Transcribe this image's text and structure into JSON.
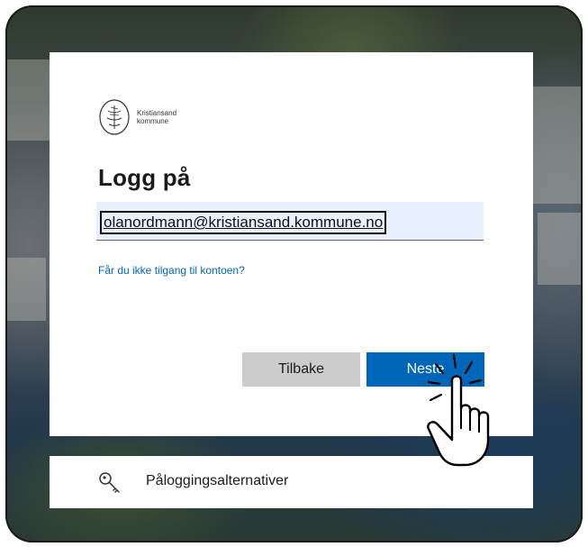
{
  "logo": {
    "icon": "kristiansand-emblem",
    "line1": "Kristiansand",
    "line2": "kommune"
  },
  "signin": {
    "title": "Logg på",
    "email_value": "olanordmann@kristiansand.kommune.no",
    "forgot_link": "Får du ikke tilgang til kontoen?",
    "back_label": "Tilbake",
    "next_label": "Neste"
  },
  "options": {
    "icon": "key-icon",
    "label": "Påloggingsalternativer"
  },
  "colors": {
    "accent": "#0067b8",
    "back_button": "#cccccc",
    "input_bg": "#e8f0fe"
  },
  "cursor": {
    "icon": "hand-pointer-icon"
  }
}
